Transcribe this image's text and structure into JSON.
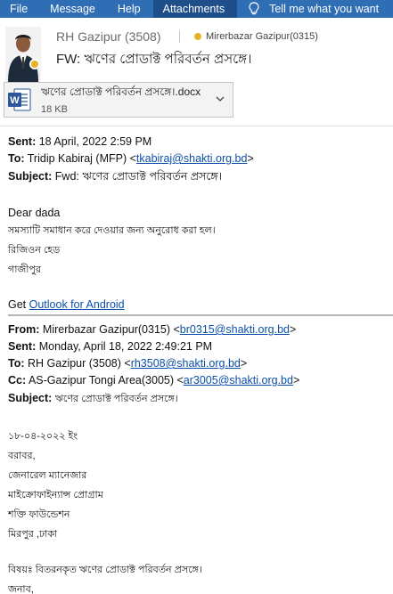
{
  "ribbon": {
    "tabs": [
      "File",
      "Message",
      "Help",
      "Attachments"
    ],
    "active": "Attachments",
    "tell_me": "Tell me what you want"
  },
  "header": {
    "sender": "RH Gazipur (3508)",
    "recipient": "Mirerbazar Gazipur(0315)",
    "subject": "FW: ঋণের প্রোডাক্ট পরিবর্তন প্রসঙ্গে।",
    "presence_color": "#e8b323"
  },
  "attachment": {
    "name": "ঋণের প্রোডাক্ট পরিবর্তন প্রসঙ্গে।.docx",
    "size": "18 KB",
    "icon": "word-doc-icon"
  },
  "forward1": {
    "sent_label": "Sent:",
    "sent_value": "18 April, 2022 2:59 PM",
    "to_label": "To:",
    "to_name": "Tridip Kabiraj (MFP) <",
    "to_email": "tkabiraj@shakti.org.bd",
    "to_close": ">",
    "subject_label": "Subject:",
    "subject_value": "Fwd: ঋণের প্রোডাক্ট পরিবর্তন প্রসঙ্গে।",
    "greeting": "Dear dada",
    "line1": "সমস্যাটি  সমাধান করে দেওয়ার জন্য অনুরোধ করা হল।",
    "line2": "রিজিওন হেড",
    "line3": "গাজীপুর",
    "get_prefix": "Get ",
    "get_link": "Outlook for Android"
  },
  "forward2": {
    "from_label": "From:",
    "from_name": "Mirerbazar Gazipur(0315) <",
    "from_email": "br0315@shakti.org.bd",
    "from_close": ">",
    "sent_label": "Sent:",
    "sent_value": "Monday, April 18, 2022 2:49:21 PM",
    "to_label": "To:",
    "to_name": "RH Gazipur (3508) <",
    "to_email": "rh3508@shakti.org.bd",
    "to_close": ">",
    "cc_label": "Cc:",
    "cc_name": "AS-Gazipur Tongi Area(3005) <",
    "cc_email": "ar3005@shakti.org.bd",
    "cc_close": ">",
    "subject_label": "Subject:",
    "subject_value": "ঋণের প্রোডাক্ট পরিবর্তন প্রসঙ্গে।"
  },
  "letter": {
    "date": "১৮-০৪-২০২২ ইং",
    "to": "বরাবর,",
    "title": "জেনারেল ম্যানেজার",
    "program": "মাইক্রোফাইন্যান্স প্রোগ্রাম",
    "org": "শক্তি ফাউন্ডেশন",
    "place": "মিরপুর ,ঢাকা",
    "subject": "বিষয়ঃ বিতরনকৃত ঋণের প্রোডাক্ট পরিবর্তন প্রসঙ্গে।",
    "salutation": "জনাব,"
  }
}
